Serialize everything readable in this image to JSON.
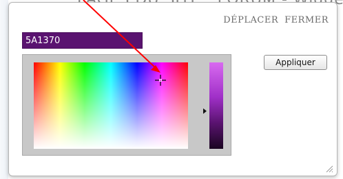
{
  "background": {
    "partial_title": "PAGES DU SITE : FORUM - Widgets"
  },
  "dialog": {
    "header": {
      "move_label": "DÉPLACER",
      "close_label": "FERMER"
    },
    "hex_input": {
      "value": "5A1370"
    },
    "apply_label": "Appliquer",
    "current_color": "#5a1370"
  },
  "icons": {
    "cursor": "crosshair-icon",
    "hue_pointer": "triangle-right-icon",
    "resize": "resize-grip-icon",
    "annotation": "red-arrow-icon"
  },
  "colors": {
    "annotation_arrow": "#ff0000",
    "hex_field_bg": "#5a1370",
    "header_text": "#6b6b6b"
  }
}
